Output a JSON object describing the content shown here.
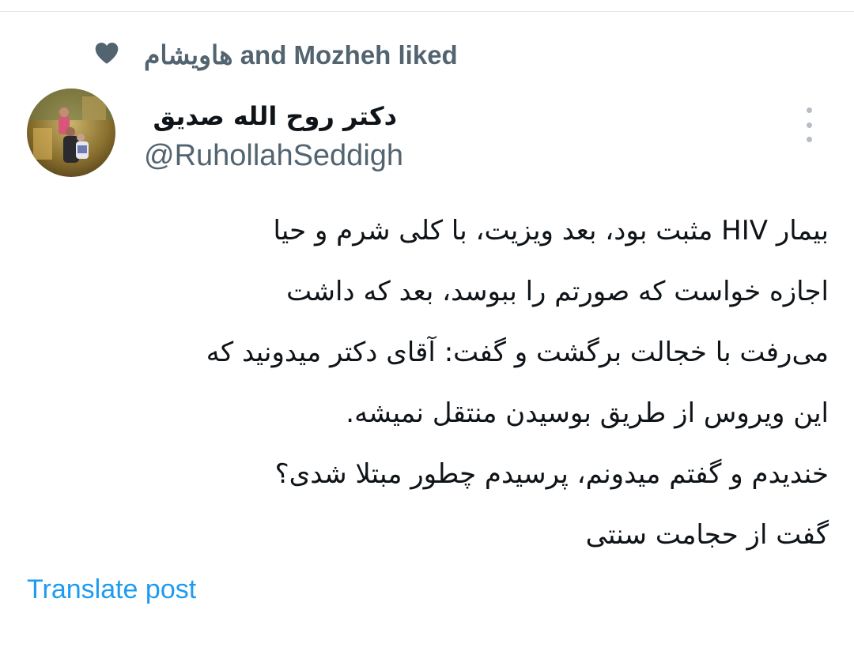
{
  "social_context": {
    "icon": "heart-icon",
    "name": "هاویشام",
    "suffix": "and Mozheh liked"
  },
  "author": {
    "display_name": "دکتر روح الله صدیق",
    "handle": "@RuhollahSeddigh",
    "avatar_icon": "avatar-photo"
  },
  "more_button": {
    "icon": "more-vertical-icon"
  },
  "tweet": {
    "lines": [
      "بیمار HIV مثبت بود، بعد ویزیت، با کلی شرم و حیا",
      "اجازه خواست که صورتم را ببوسد، بعد که داشت",
      "می‌رفت با خجالت برگشت و گفت: آقای دکتر میدونید که",
      "این ویروس از طریق بوسیدن منتقل نمیشه.",
      "خندیدم و گفتم میدونم، پرسیدم چطور مبتلا شدی؟",
      "گفت از حجامت سنتی"
    ]
  },
  "translate_label": "Translate post",
  "colors": {
    "secondary_text": "#536471",
    "primary_text": "#0f1419",
    "link": "#1d9bf0"
  }
}
